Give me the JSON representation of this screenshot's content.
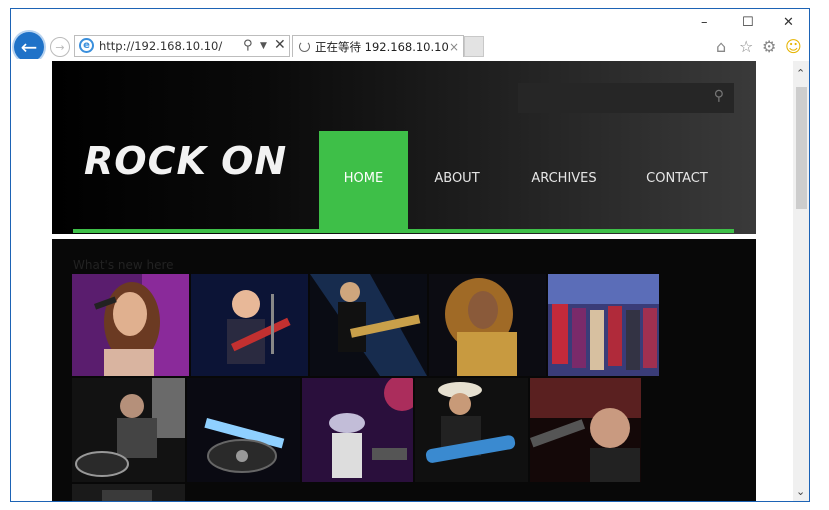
{
  "window": {
    "minimize": "–",
    "maximize": "☐",
    "close": "✕"
  },
  "browser": {
    "back_icon": "back-arrow-icon",
    "forward_icon": "forward-arrow-icon",
    "address_url": "http://192.168.10.10/",
    "tab_title": "正在等待 192.168.10.10",
    "tab_close": "×",
    "toolbar_icons": [
      "home-icon",
      "star-icon",
      "gear-icon",
      "smiley-icon"
    ]
  },
  "site": {
    "logo": "ROCK ON",
    "nav": [
      {
        "label": "HOME",
        "active": true
      },
      {
        "label": "ABOUT",
        "active": false
      },
      {
        "label": "ARCHIVES",
        "active": false
      },
      {
        "label": "CONTACT",
        "active": false
      }
    ],
    "section_title": "What's new here",
    "accent_color": "#3ebf48",
    "gallery": [
      "singer-purple-microphone",
      "guitarist-blue-light",
      "guitarist-stage-light",
      "singer-gold-dress",
      "band-colorful-stage",
      "dj-turntable",
      "dj-mixer-glow",
      "performer-purple-light",
      "guitarist-cowboy-hat",
      "singer-red-light"
    ]
  }
}
